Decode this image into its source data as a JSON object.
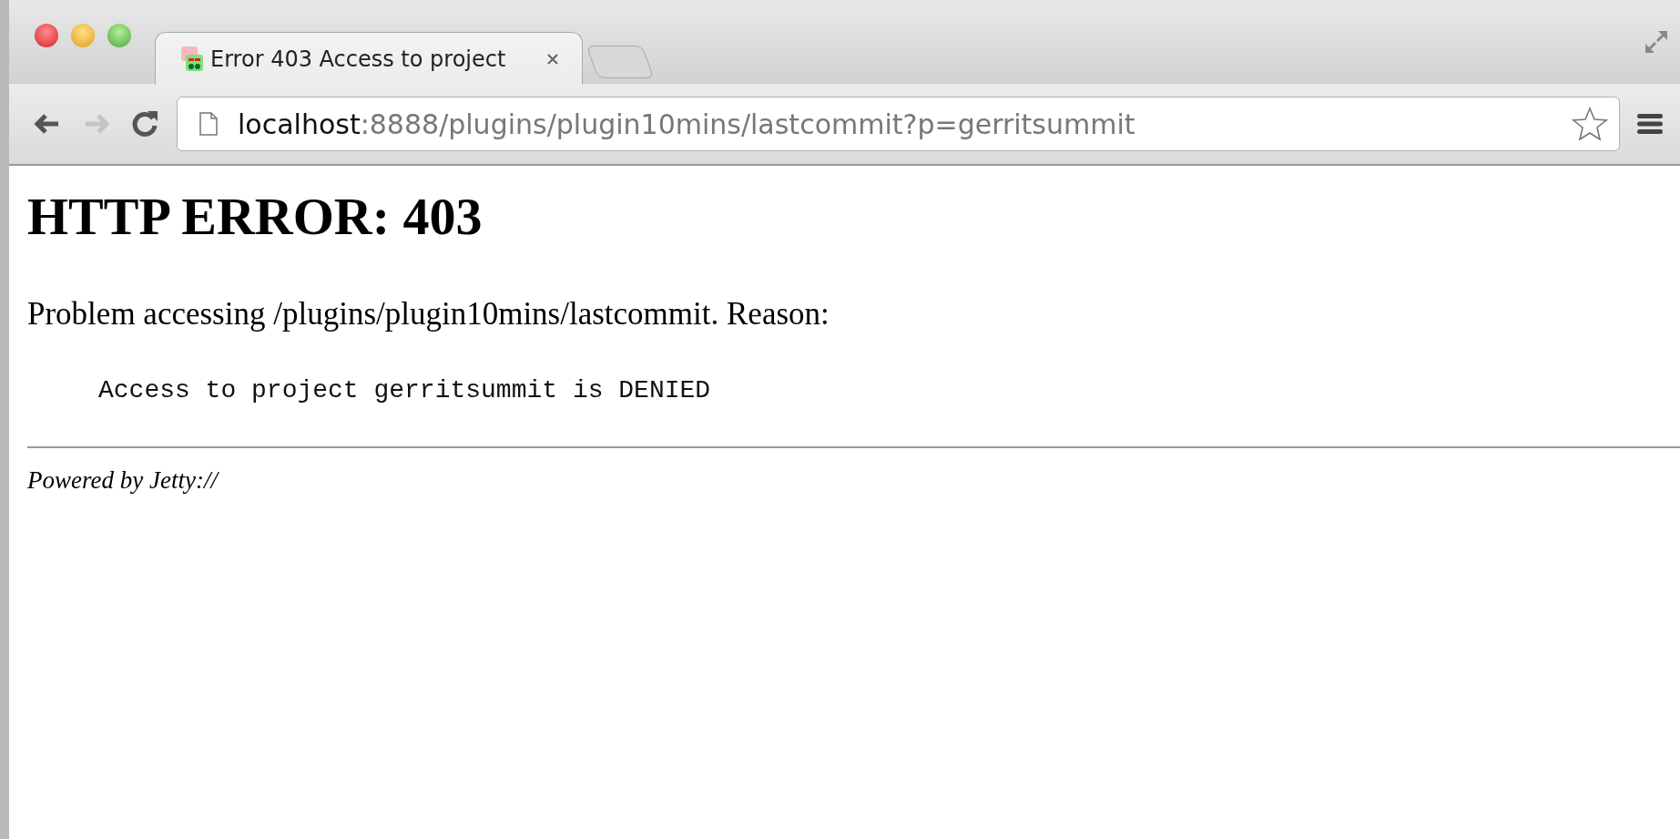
{
  "tabs": [
    {
      "title": "Error 403 Access to project",
      "selected": true
    }
  ],
  "toolbar": {
    "back_disabled": false,
    "forward_disabled": true
  },
  "address": {
    "host": "localhost",
    "rest": ":8888/plugins/plugin10mins/lastcommit?p=gerritsummit"
  },
  "page": {
    "heading": "HTTP ERROR: 403",
    "problem": "Problem accessing /plugins/plugin10mins/lastcommit. Reason:",
    "reason": "Access to project gerritsummit is DENIED",
    "footer": "Powered by Jetty://"
  }
}
